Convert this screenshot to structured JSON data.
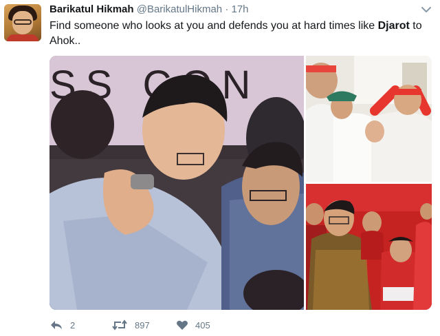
{
  "tweet": {
    "author_name": "Barikatul Hikmah",
    "handle": "@BarikatulHikmah",
    "separator": "·",
    "time": "17h",
    "text_part1": "Find someone who looks at you and defends you at hard times like ",
    "text_bold": "Djarot",
    "text_part2": " to Ahok..",
    "photo_sign_text": "SS CON"
  },
  "actions": {
    "reply_count": "2",
    "retweet_count": "897",
    "like_count": "405"
  },
  "colors": {
    "muted": "#657786",
    "text": "#14171a"
  },
  "icons": {
    "reply": "reply-icon",
    "retweet": "retweet-icon",
    "like": "heart-icon",
    "menu": "chevron-down-icon"
  }
}
